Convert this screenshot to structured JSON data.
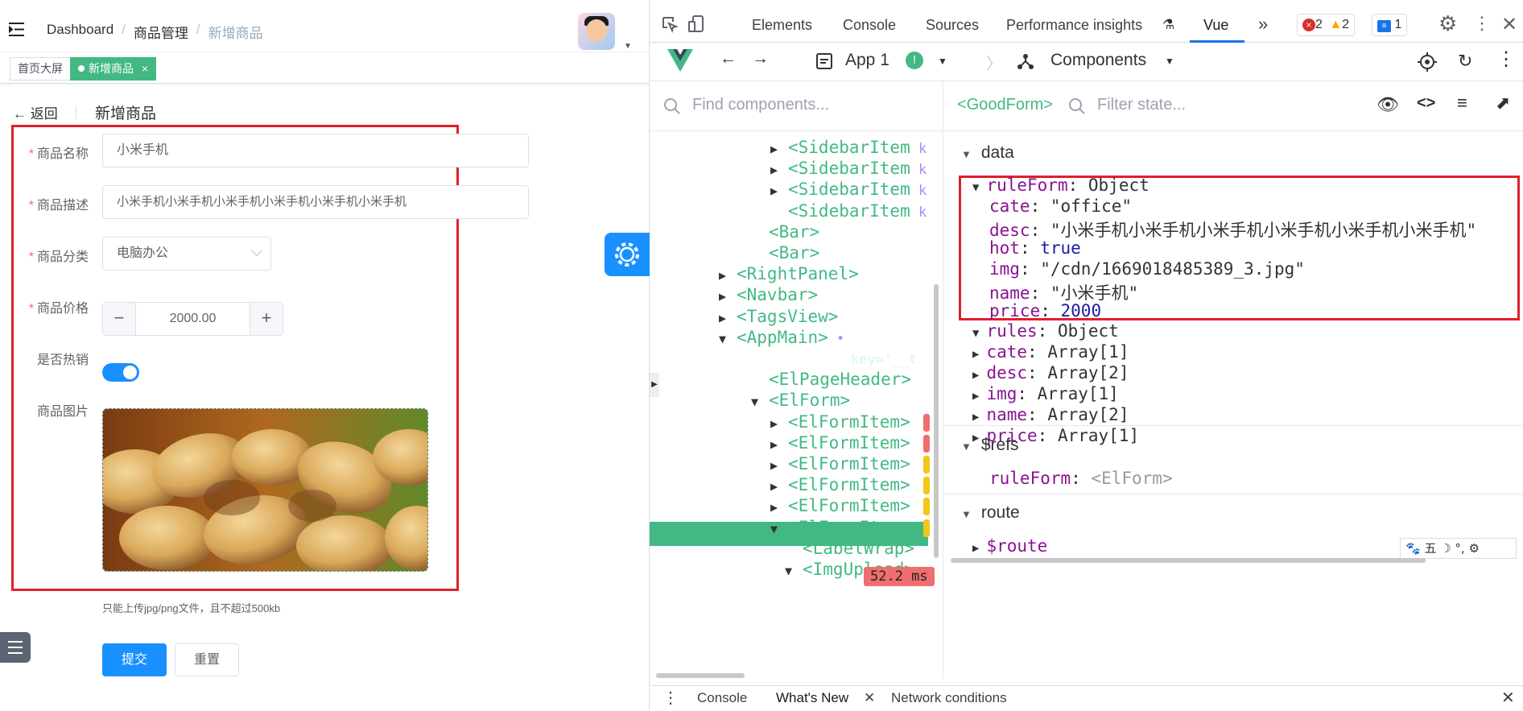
{
  "app": {
    "breadcrumb": [
      "Dashboard",
      "商品管理",
      "新增商品"
    ],
    "tags": {
      "home": "首页大屏",
      "active": "新增商品",
      "close": "×"
    },
    "header": {
      "back": "返回",
      "title": "新增商品"
    },
    "form": {
      "name_label": "商品名称",
      "name_value": "小米手机",
      "desc_label": "商品描述",
      "desc_value": "小米手机小米手机小米手机小米手机小米手机小米手机",
      "cate_label": "商品分类",
      "cate_value": "电脑办公",
      "price_label": "商品价格",
      "price_value": "2000.00",
      "minus": "−",
      "plus": "+",
      "hot_label": "是否热销",
      "hot_on": true,
      "img_label": "商品图片",
      "tip": "只能上传jpg/png文件，且不超过500kb",
      "submit": "提交",
      "reset": "重置"
    },
    "accent": "#1890ff",
    "required_mark": "*"
  },
  "devtools": {
    "tabs": [
      "Elements",
      "Console",
      "Sources",
      "Performance insights",
      "Vue"
    ],
    "more": "»",
    "errors": "2",
    "warnings": "2",
    "messages": "1",
    "vue_bar": {
      "app": "App 1",
      "view": "Components"
    },
    "find_placeholder": "Find components...",
    "selected_component": "<GoodForm>",
    "filter_placeholder": "Filter state...",
    "tree": [
      {
        "tag": "<SidebarItem",
        "suffix": " k",
        "arrow": "▶"
      },
      {
        "tag": "<SidebarItem",
        "suffix": " k",
        "arrow": "▶"
      },
      {
        "tag": "<SidebarItem",
        "suffix": " k",
        "arrow": "▶"
      },
      {
        "tag": "<SidebarItem",
        "suffix": " k",
        "arrow": ""
      },
      {
        "tag": "<Bar>",
        "suffix": "",
        "arrow": ""
      },
      {
        "tag": "<Bar>",
        "suffix": "",
        "arrow": ""
      },
      {
        "tag": "<RightPanel>",
        "suffix": "",
        "arrow": "▶"
      },
      {
        "tag": "<Navbar>",
        "suffix": "",
        "arrow": "▶"
      },
      {
        "tag": "<TagsView>",
        "suffix": "",
        "arrow": "▶"
      },
      {
        "tag": "<AppMain>",
        "suffix": " •",
        "arrow": "▼"
      },
      {
        "tag": "<GoodForm",
        "suffix": " key='__t",
        "arrow": "▼"
      },
      {
        "tag": "<ElPageHeader>",
        "suffix": "",
        "arrow": ""
      },
      {
        "tag": "<ElForm>",
        "suffix": "",
        "arrow": "▼"
      },
      {
        "tag": "<ElFormItem>",
        "suffix": "",
        "arrow": "▶"
      },
      {
        "tag": "<ElFormItem>",
        "suffix": "",
        "arrow": "▶"
      },
      {
        "tag": "<ElFormItem>",
        "suffix": "",
        "arrow": "▶"
      },
      {
        "tag": "<ElFormItem>",
        "suffix": "",
        "arrow": "▶"
      },
      {
        "tag": "<ElFormItem>",
        "suffix": "",
        "arrow": "▶"
      },
      {
        "tag": "<ElFormItem>",
        "suffix": "",
        "arrow": "▼"
      },
      {
        "tag": "<LabelWrap>",
        "suffix": "",
        "arrow": ""
      },
      {
        "tag": "<ImgUpload>",
        "suffix": "",
        "arrow": "▼"
      }
    ],
    "elform_time": "52.2 ms",
    "state": {
      "data_title": "data",
      "ruleForm_key": "ruleForm",
      "ruleForm_type": "Object",
      "fields": [
        {
          "key": "cate",
          "value": "\"office\""
        },
        {
          "key": "desc",
          "value": "\"小米手机小米手机小米手机小米手机小米手机小米手机\""
        },
        {
          "key": "hot",
          "value": "true"
        },
        {
          "key": "img",
          "value": "\"/cdn/1669018485389_3.jpg\""
        },
        {
          "key": "name",
          "value": "\"小米手机\""
        },
        {
          "key": "price",
          "value": "2000"
        }
      ],
      "rules_key": "rules",
      "rules_type": "Object",
      "rules": [
        {
          "key": "cate",
          "value": "Array[1]"
        },
        {
          "key": "desc",
          "value": "Array[2]"
        },
        {
          "key": "img",
          "value": "Array[1]"
        },
        {
          "key": "name",
          "value": "Array[2]"
        },
        {
          "key": "price",
          "value": "Array[1]"
        }
      ],
      "refs_title": "$refs",
      "refs_key": "ruleForm",
      "refs_value": "<ElForm>",
      "route_title": "route",
      "route_key": "$route"
    },
    "drawer_tabs": [
      "Console",
      "What's New",
      "Network conditions"
    ]
  }
}
